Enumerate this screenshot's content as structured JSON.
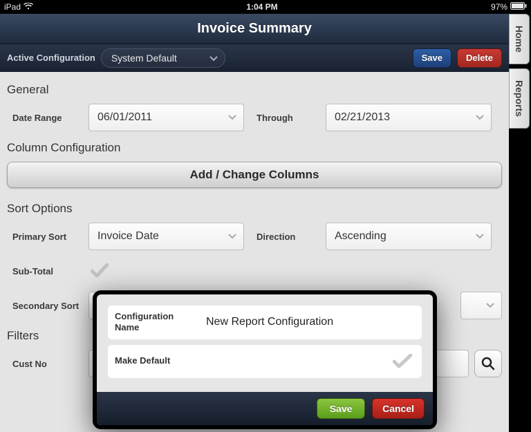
{
  "status": {
    "device": "iPad",
    "time": "1:04 PM",
    "battery_pct": "97%"
  },
  "side_tabs": {
    "home": "Home",
    "reports": "Reports"
  },
  "header": {
    "title": "Invoice Summary"
  },
  "config_bar": {
    "label": "Active Configuration",
    "value": "System Default",
    "save_label": "Save",
    "delete_label": "Delete"
  },
  "sections": {
    "general": "General",
    "column_config": "Column Configuration",
    "sort_options": "Sort Options",
    "filters": "Filters"
  },
  "general": {
    "date_range_label": "Date Range",
    "date_from": "06/01/2011",
    "through_label": "Through",
    "date_to": "02/21/2013"
  },
  "columns": {
    "button_label": "Add / Change Columns"
  },
  "sort": {
    "primary_label": "Primary Sort",
    "primary_value": "Invoice Date",
    "direction_label": "Direction",
    "direction_value": "Ascending",
    "subtotal_label": "Sub-Total",
    "secondary_label": "Secondary Sort",
    "secondary_value": ""
  },
  "filters_row": {
    "cust_no_label": "Cust No",
    "cust_no_value": ""
  },
  "modal": {
    "name_label": "Configuration Name",
    "name_value": "New Report Configuration",
    "make_default_label": "Make Default",
    "save_label": "Save",
    "cancel_label": "Cancel"
  }
}
